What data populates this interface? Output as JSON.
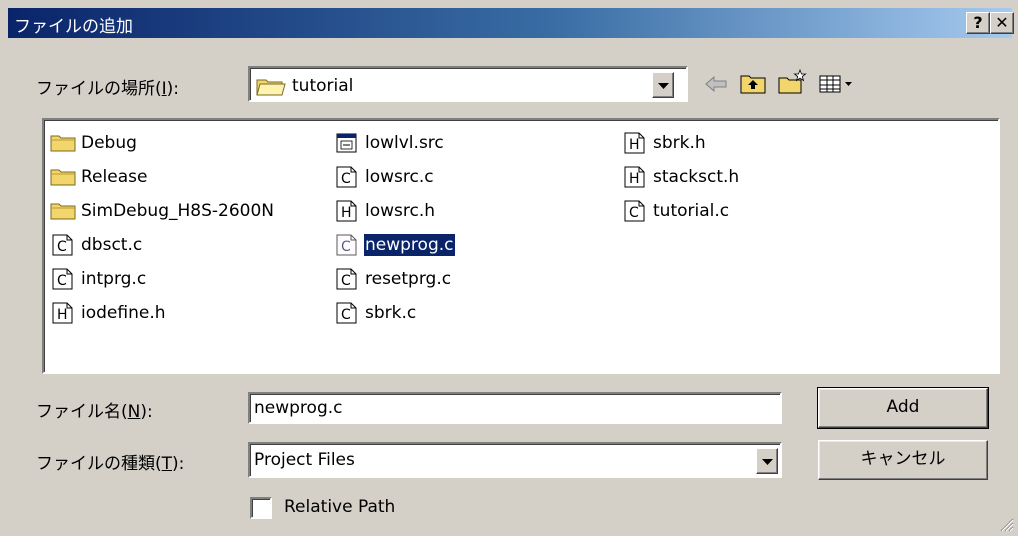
{
  "window": {
    "title": "ファイルの追加",
    "help_glyph": "?",
    "close_glyph": "✕"
  },
  "look_in": {
    "label_pre": "ファイルの場所(",
    "label_key": "I",
    "label_post": "):",
    "value": "tutorial"
  },
  "toolbar": {
    "icons": [
      "back-arrow-icon",
      "up-folder-icon",
      "new-folder-icon",
      "view-menu-icon"
    ]
  },
  "files": {
    "col1": [
      {
        "name": "Debug",
        "icon": "folder-icon"
      },
      {
        "name": "Release",
        "icon": "folder-icon"
      },
      {
        "name": "SimDebug_H8S-2600N",
        "icon": "folder-icon"
      },
      {
        "name": "dbsct.c",
        "icon": "c-file-icon"
      },
      {
        "name": "intprg.c",
        "icon": "c-file-icon"
      },
      {
        "name": "iodefine.h",
        "icon": "h-file-icon"
      }
    ],
    "col2": [
      {
        "name": "lowlvl.src",
        "icon": "asm-file-icon"
      },
      {
        "name": "lowsrc.c",
        "icon": "c-file-icon"
      },
      {
        "name": "lowsrc.h",
        "icon": "h-file-icon"
      },
      {
        "name": "newprog.c",
        "icon": "c-file-icon",
        "selected": true
      },
      {
        "name": "resetprg.c",
        "icon": "c-file-icon"
      },
      {
        "name": "sbrk.c",
        "icon": "c-file-icon"
      }
    ],
    "col3": [
      {
        "name": "sbrk.h",
        "icon": "h-file-icon"
      },
      {
        "name": "stacksct.h",
        "icon": "h-file-icon"
      },
      {
        "name": "tutorial.c",
        "icon": "c-file-icon"
      }
    ]
  },
  "file_name": {
    "label_pre": "ファイル名(",
    "label_key": "N",
    "label_post": "):",
    "value": "newprog.c"
  },
  "file_type": {
    "label_pre": "ファイルの種類(",
    "label_key": "T",
    "label_post": "):",
    "value": "Project Files"
  },
  "buttons": {
    "add": "Add",
    "cancel": "キャンセル"
  },
  "relative_path": {
    "label": "Relative Path",
    "checked": false
  },
  "colors": {
    "face": "#d4d0c8",
    "title_start": "#0a246a",
    "title_end": "#a6caf0",
    "selection": "#0a246a",
    "folder": "#f2d66b"
  }
}
